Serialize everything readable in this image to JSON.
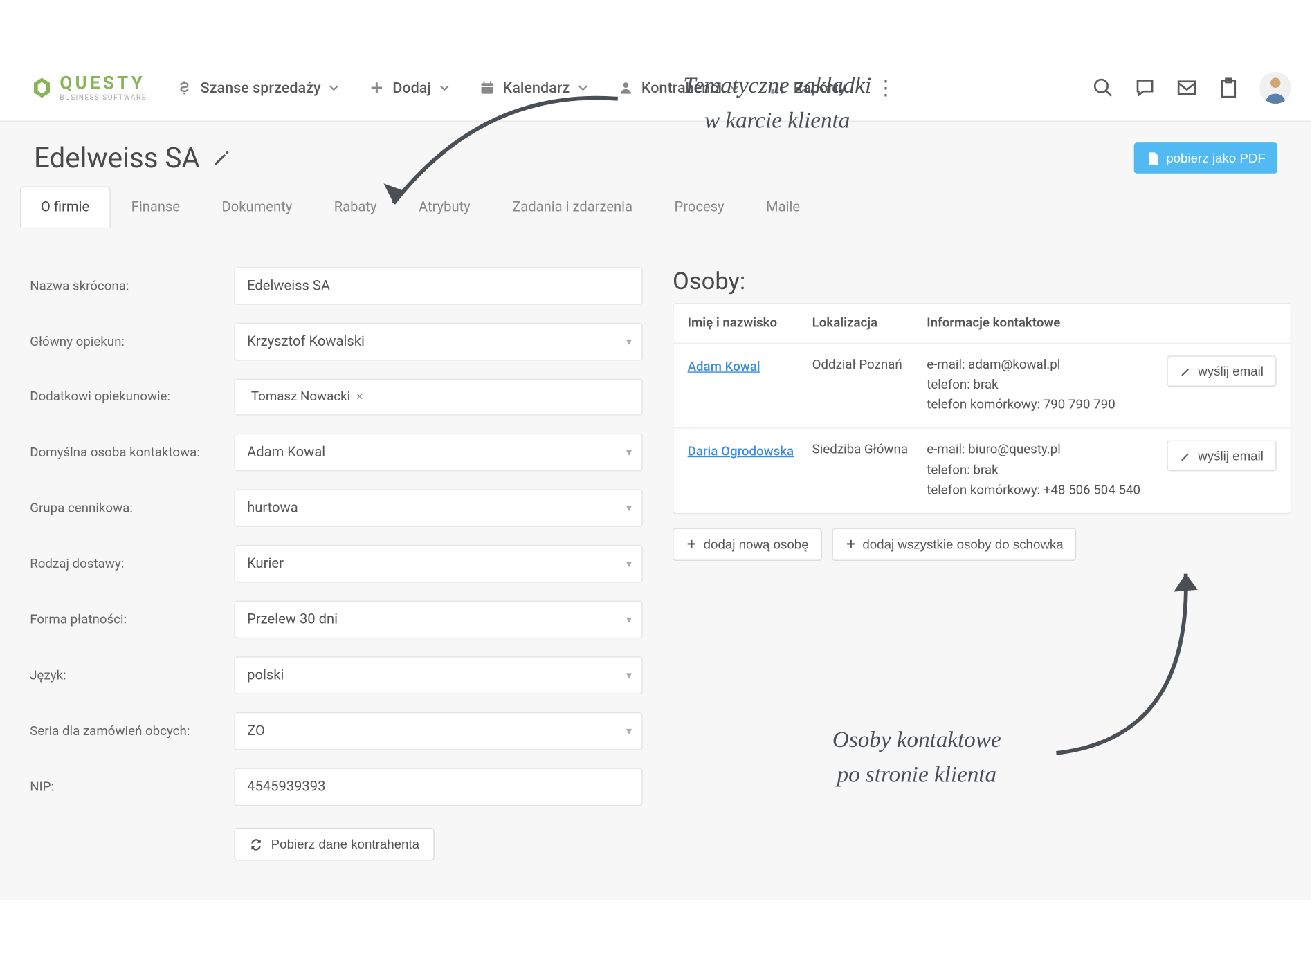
{
  "annotations": {
    "top_line1": "Tematyczne zakładki",
    "top_line2": "w karcie klienta",
    "bottom_line1": "Osoby kontaktowe",
    "bottom_line2": "po stronie klienta"
  },
  "logo": {
    "main": "QUESTY",
    "sub": "BUSINESS SOFTWARE"
  },
  "nav": {
    "sales": "Szanse sprzedaży",
    "add": "Dodaj",
    "calendar": "Kalendarz",
    "contractors": "Kontrahenci",
    "reports": "Raporty"
  },
  "page": {
    "title": "Edelweiss SA",
    "pdf": "pobierz jako PDF"
  },
  "tabs": [
    "O firmie",
    "Finanse",
    "Dokumenty",
    "Rabaty",
    "Atrybuty",
    "Zadania i zdarzenia",
    "Procesy",
    "Maile"
  ],
  "form": {
    "nazwa_skrocona": {
      "label": "Nazwa skrócona:",
      "value": "Edelweiss SA"
    },
    "glowny_opiekun": {
      "label": "Główny opiekun:",
      "value": "Krzysztof Kowalski"
    },
    "dodatkowi": {
      "label": "Dodatkowi opiekunowie:",
      "tag": "Tomasz Nowacki"
    },
    "domyslna_osoba": {
      "label": "Domyślna osoba kontaktowa:",
      "value": "Adam Kowal"
    },
    "grupa_cennikowa": {
      "label": "Grupa cennikowa:",
      "value": "hurtowa"
    },
    "rodzaj_dostawy": {
      "label": "Rodzaj dostawy:",
      "value": "Kurier"
    },
    "forma_platnosci": {
      "label": "Forma płatności:",
      "value": "Przelew 30 dni"
    },
    "jezyk": {
      "label": "Język:",
      "value": "polski"
    },
    "seria": {
      "label": "Seria dla zamówień obcych:",
      "value": "ZO"
    },
    "nip": {
      "label": "NIP:",
      "value": "4545939393"
    },
    "pobierz_dane": "Pobierz dane kontrahenta"
  },
  "persons": {
    "title": "Osoby:",
    "headers": {
      "name": "Imię i nazwisko",
      "loc": "Lokalizacja",
      "info": "Informacje kontaktowe"
    },
    "rows": [
      {
        "name": "Adam Kowal",
        "loc": "Oddział Poznań",
        "email": "e-mail: adam@kowal.pl",
        "phone": "telefon: brak",
        "mobile": "telefon komórkowy: 790 790 790"
      },
      {
        "name": "Daria Ogrodowska",
        "loc": "Siedziba Główna",
        "email": "e-mail: biuro@questy.pl",
        "phone": "telefon: brak",
        "mobile": "telefon komórkowy: +48 506 504 540"
      }
    ],
    "send_email": "wyślij email",
    "add_person": "dodaj nową osobę",
    "add_all": "dodaj wszystkie osoby do schowka"
  }
}
